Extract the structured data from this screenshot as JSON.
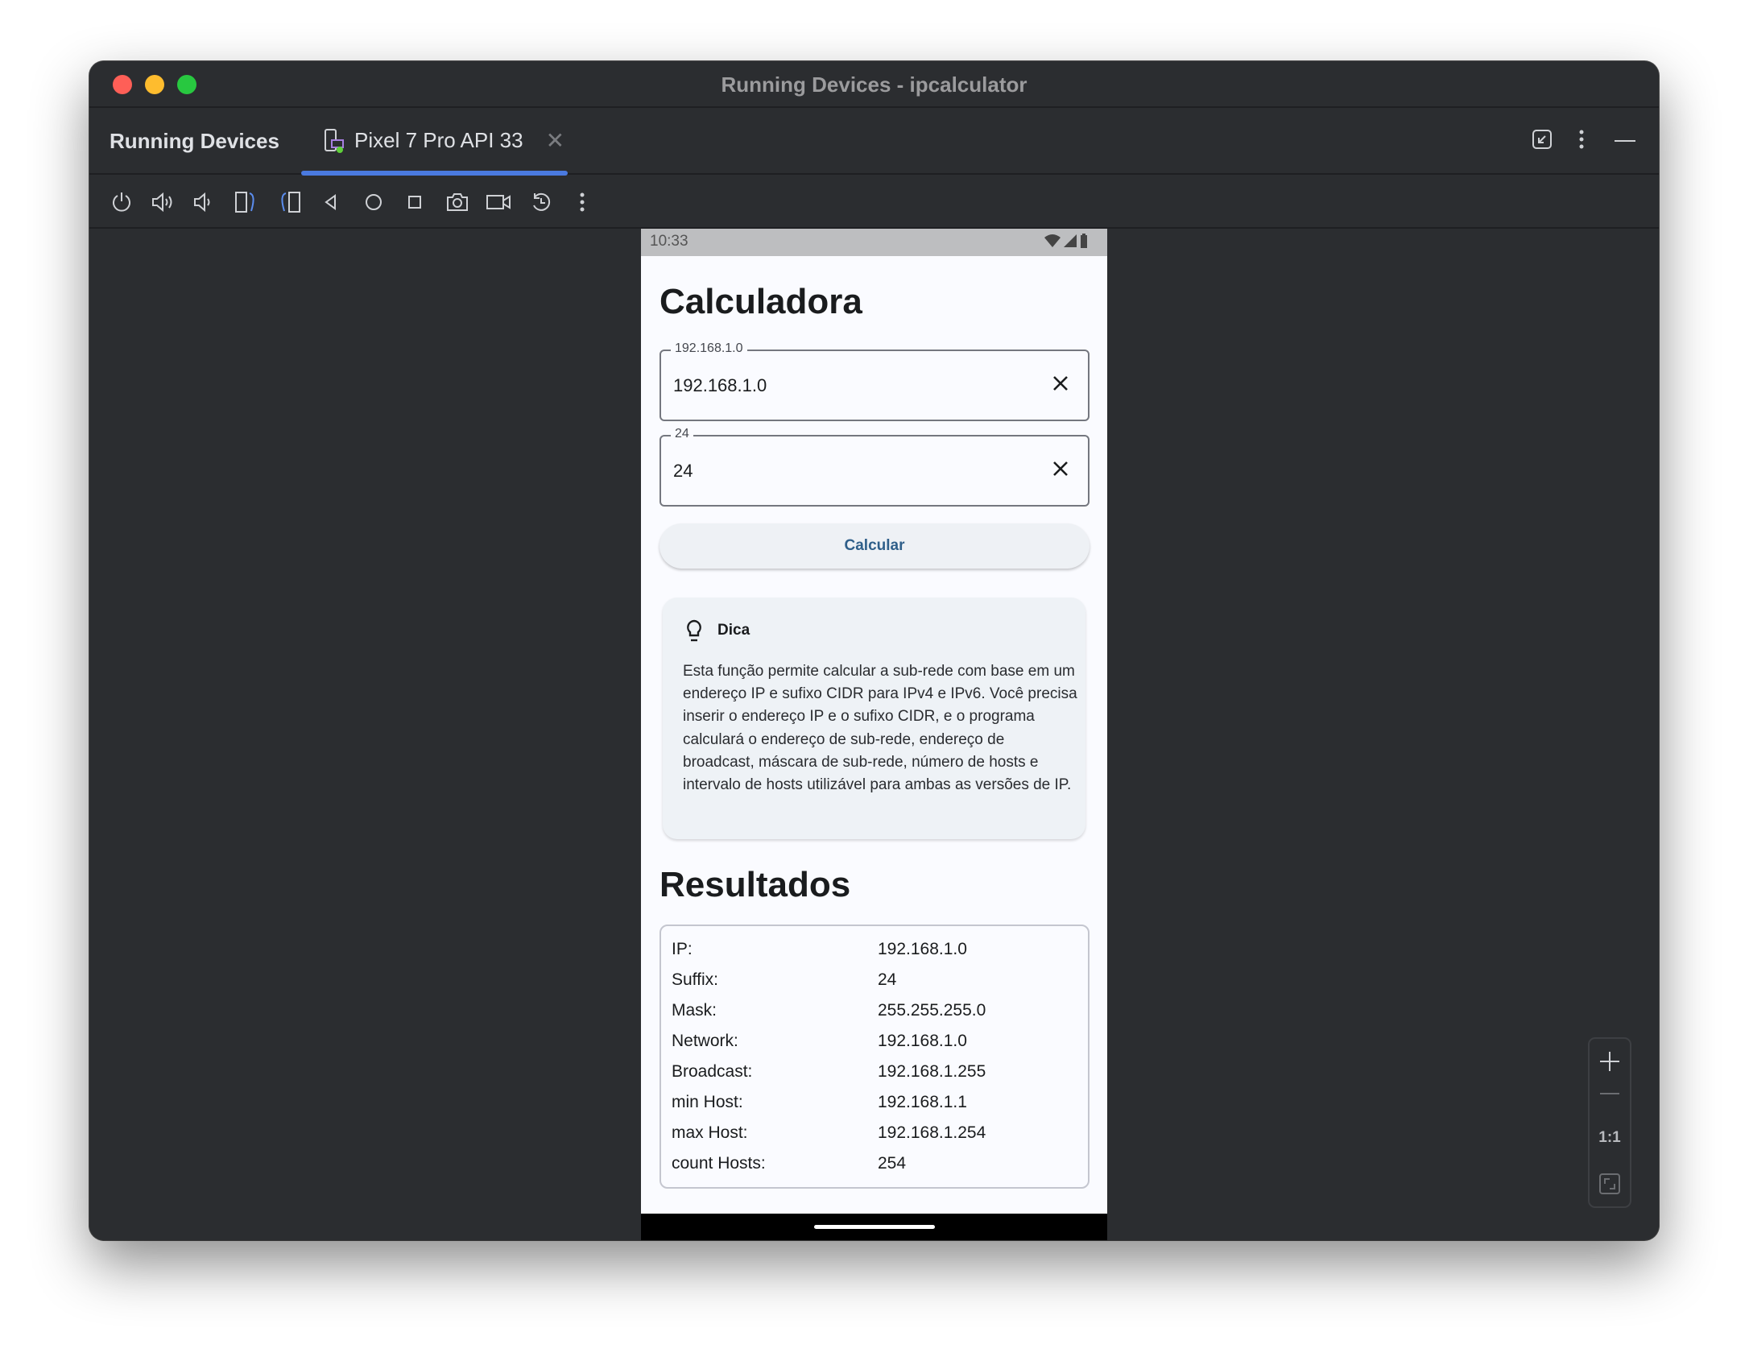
{
  "window": {
    "title": "Running Devices - ipcalculator",
    "traffic_lights": {
      "close": "#fe5f57",
      "minimize": "#febc2e",
      "maximize": "#28c840"
    }
  },
  "tabbar": {
    "panel_title": "Running Devices",
    "tab_label": "Pixel 7 Pro API 33",
    "tab_icon": "device-icon",
    "accent": "#4a7ae0"
  },
  "toolbar": {
    "icons": [
      "power-icon",
      "volume-up-icon",
      "volume-down-icon",
      "rotate-left-icon",
      "rotate-right-icon",
      "back-icon",
      "home-icon",
      "overview-icon",
      "screenshot-icon",
      "screen-record-icon",
      "reset-icon",
      "more-icon"
    ]
  },
  "phone": {
    "status": {
      "time": "10:33"
    },
    "title": "Calculadora",
    "ip_field": {
      "label": "192.168.1.0",
      "value": "192.168.1.0"
    },
    "cidr_field": {
      "label": "24",
      "value": "24"
    },
    "calc_button": "Calcular",
    "tip": {
      "title": "Dica",
      "body": "Esta função permite calcular a sub-rede com base em um endereço IP e sufixo CIDR para IPv4 e IPv6. Você precisa inserir o endereço IP e o sufixo CIDR, e o programa calculará o endereço de sub-rede, endereço de broadcast, máscara de sub-rede, número de hosts e intervalo de hosts utilizável para ambas as versões de IP."
    },
    "results_title": "Resultados",
    "results": [
      {
        "label": "IP:",
        "value": "192.168.1.0"
      },
      {
        "label": "Suffix:",
        "value": "24"
      },
      {
        "label": "Mask:",
        "value": "255.255.255.0"
      },
      {
        "label": "Network:",
        "value": "192.168.1.0"
      },
      {
        "label": "Broadcast:",
        "value": "192.168.1.255"
      },
      {
        "label": "min Host:",
        "value": "192.168.1.1"
      },
      {
        "label": "max Host:",
        "value": "192.168.1.254"
      },
      {
        "label": "count Hosts:",
        "value": "254"
      }
    ]
  },
  "zoom_controls": {
    "actual_size": "1:1"
  }
}
